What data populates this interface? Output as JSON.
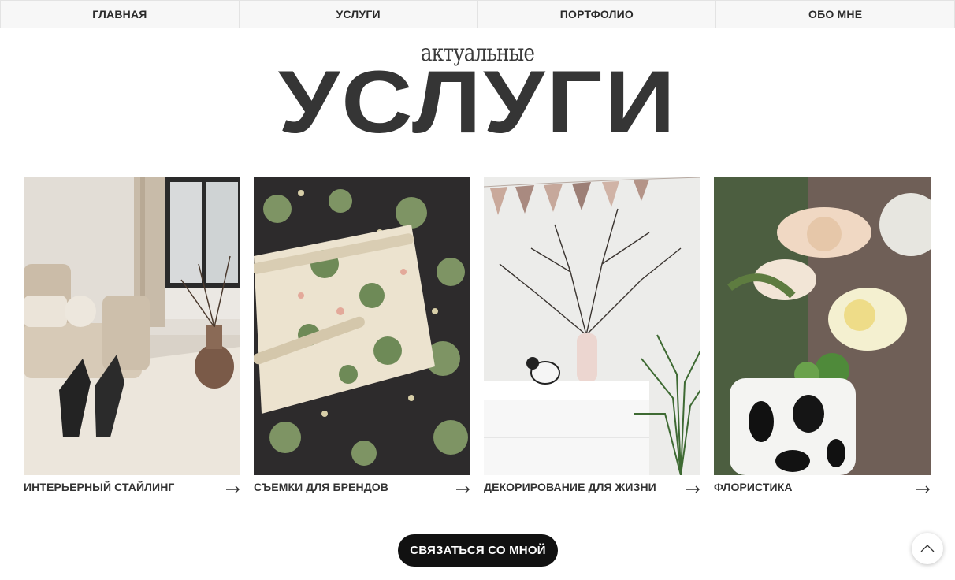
{
  "nav": {
    "items": [
      {
        "label": "ГЛАВНАЯ"
      },
      {
        "label": "УСЛУГИ"
      },
      {
        "label": "ПОРТФОЛИО"
      },
      {
        "label": "ОБО МНЕ"
      }
    ]
  },
  "section": {
    "subtitle": "актуальные",
    "title": "УСЛУГИ"
  },
  "services": [
    {
      "title": "ИНТЕРЬЕРНЫЙ СТАЙЛИНГ",
      "image": "sofa-interior-photo"
    },
    {
      "title": "СЪЕМКИ ДЛЯ БРЕНДОВ",
      "image": "floral-wallpaper-photo"
    },
    {
      "title": "ДЕКОРИРОВАНИЕ ДЛЯ ЖИЗНИ",
      "image": "room-decor-photo"
    },
    {
      "title": "ФЛОРИСТИКА",
      "image": "flower-vase-photo"
    }
  ],
  "cta": {
    "label": "СВЯЗАТЬСЯ СО МНОЙ"
  },
  "icons": {
    "arrow": "arrow-right-icon",
    "scroll_top": "chevron-up-icon"
  }
}
